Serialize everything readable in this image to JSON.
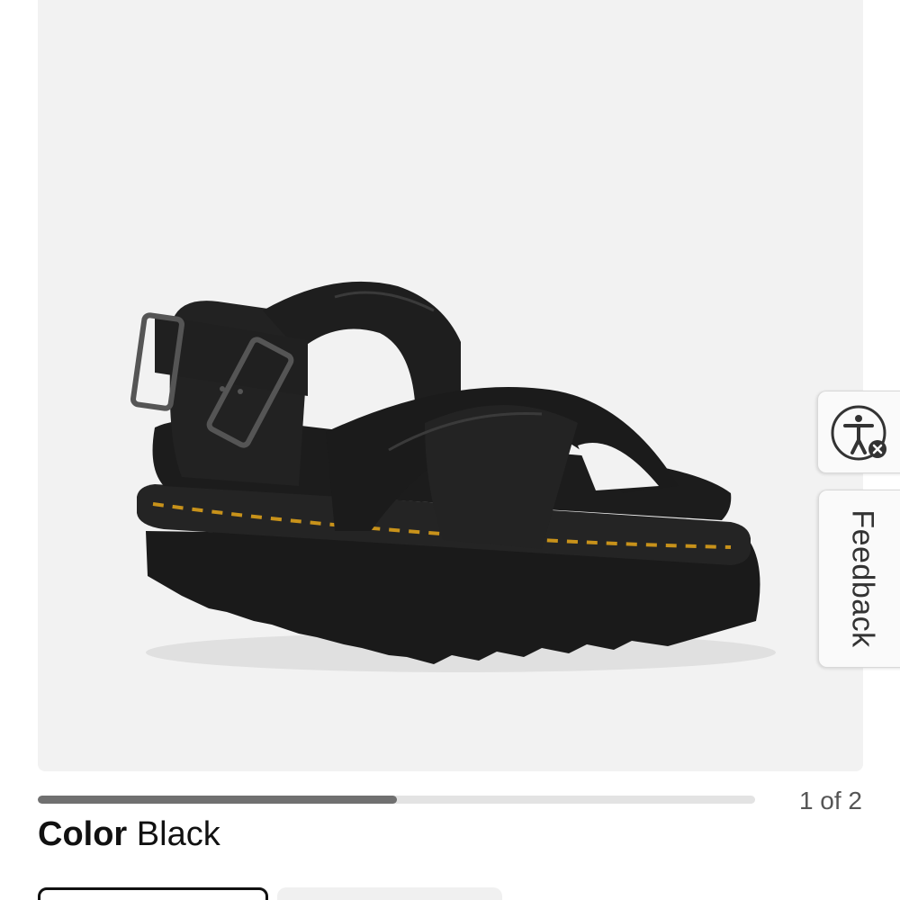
{
  "product": {
    "image_icon": "black-leather-sandal-photo",
    "background_color": "#f2f2f2"
  },
  "side_tabs": {
    "accessibility_icon": "accessibility-person-icon",
    "feedback_label": "Feedback"
  },
  "carousel": {
    "progress_fraction": 0.5,
    "counter": "1 of 2"
  },
  "color": {
    "label": "Color",
    "value": "Black"
  },
  "colors": {
    "accent": "#111111",
    "stitching": "#c8921a",
    "progress_fill": "#707070",
    "progress_track": "#e3e3e3"
  }
}
